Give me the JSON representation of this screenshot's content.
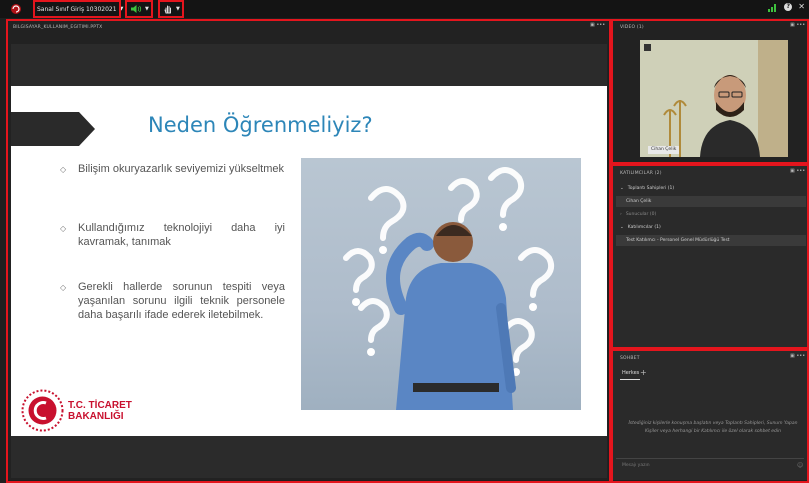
{
  "topbar": {
    "meeting_menu_label": "Sanal Sınıf Giriş 10302021",
    "audio_label": "",
    "hand_label": "",
    "colors": {
      "highlight": "#e4151d",
      "bar": "#141414"
    }
  },
  "share_pod": {
    "header": "BILGISAYAR_KULLANIM_EGITIMI.PPTX",
    "slide": {
      "title": "Neden Öğrenmeliyiz?",
      "bullets": [
        "Bilişim okuryazarlık seviyemizi yükseltmek",
        "Kullandığımız teknolojiyi daha iyi kavramak, tanımak",
        "Gerekli hallerde sorunun tespiti veya yaşanılan sorunu ilgili teknik personele daha başarılı ifade ederek iletebilmek."
      ],
      "brand_line1": "T.C. TİCARET",
      "brand_line2": "BAKANLIĞI"
    }
  },
  "video_pod": {
    "header": "VIDEO (1)",
    "name_tag": "Cihan Çelik"
  },
  "attendees_pod": {
    "header": "KATILIMCILAR (2)",
    "groups": [
      {
        "label": "Toplantı Sahipleri (1)",
        "expanded": true
      },
      {
        "label": "Cihan Çelik",
        "is_member": true
      },
      {
        "label": "Sunucular (0)",
        "expanded": false
      },
      {
        "label": "Katılımcılar (1)",
        "expanded": true
      },
      {
        "label": "Test Katılımcı - Personel Genel Müdürlüğü Test",
        "is_member": true
      }
    ]
  },
  "chat_pod": {
    "header": "SOHBET",
    "tab_label": "Herkes",
    "empty_message": "İstediğiniz kişilerle konuşma başlatın veya Toplantı Sahipleri, Sunum Yapan Kişiler veya herhangi bir Katılımcı ile özel olarak sohbet edin",
    "input_placeholder": "Mesajı yazın"
  }
}
